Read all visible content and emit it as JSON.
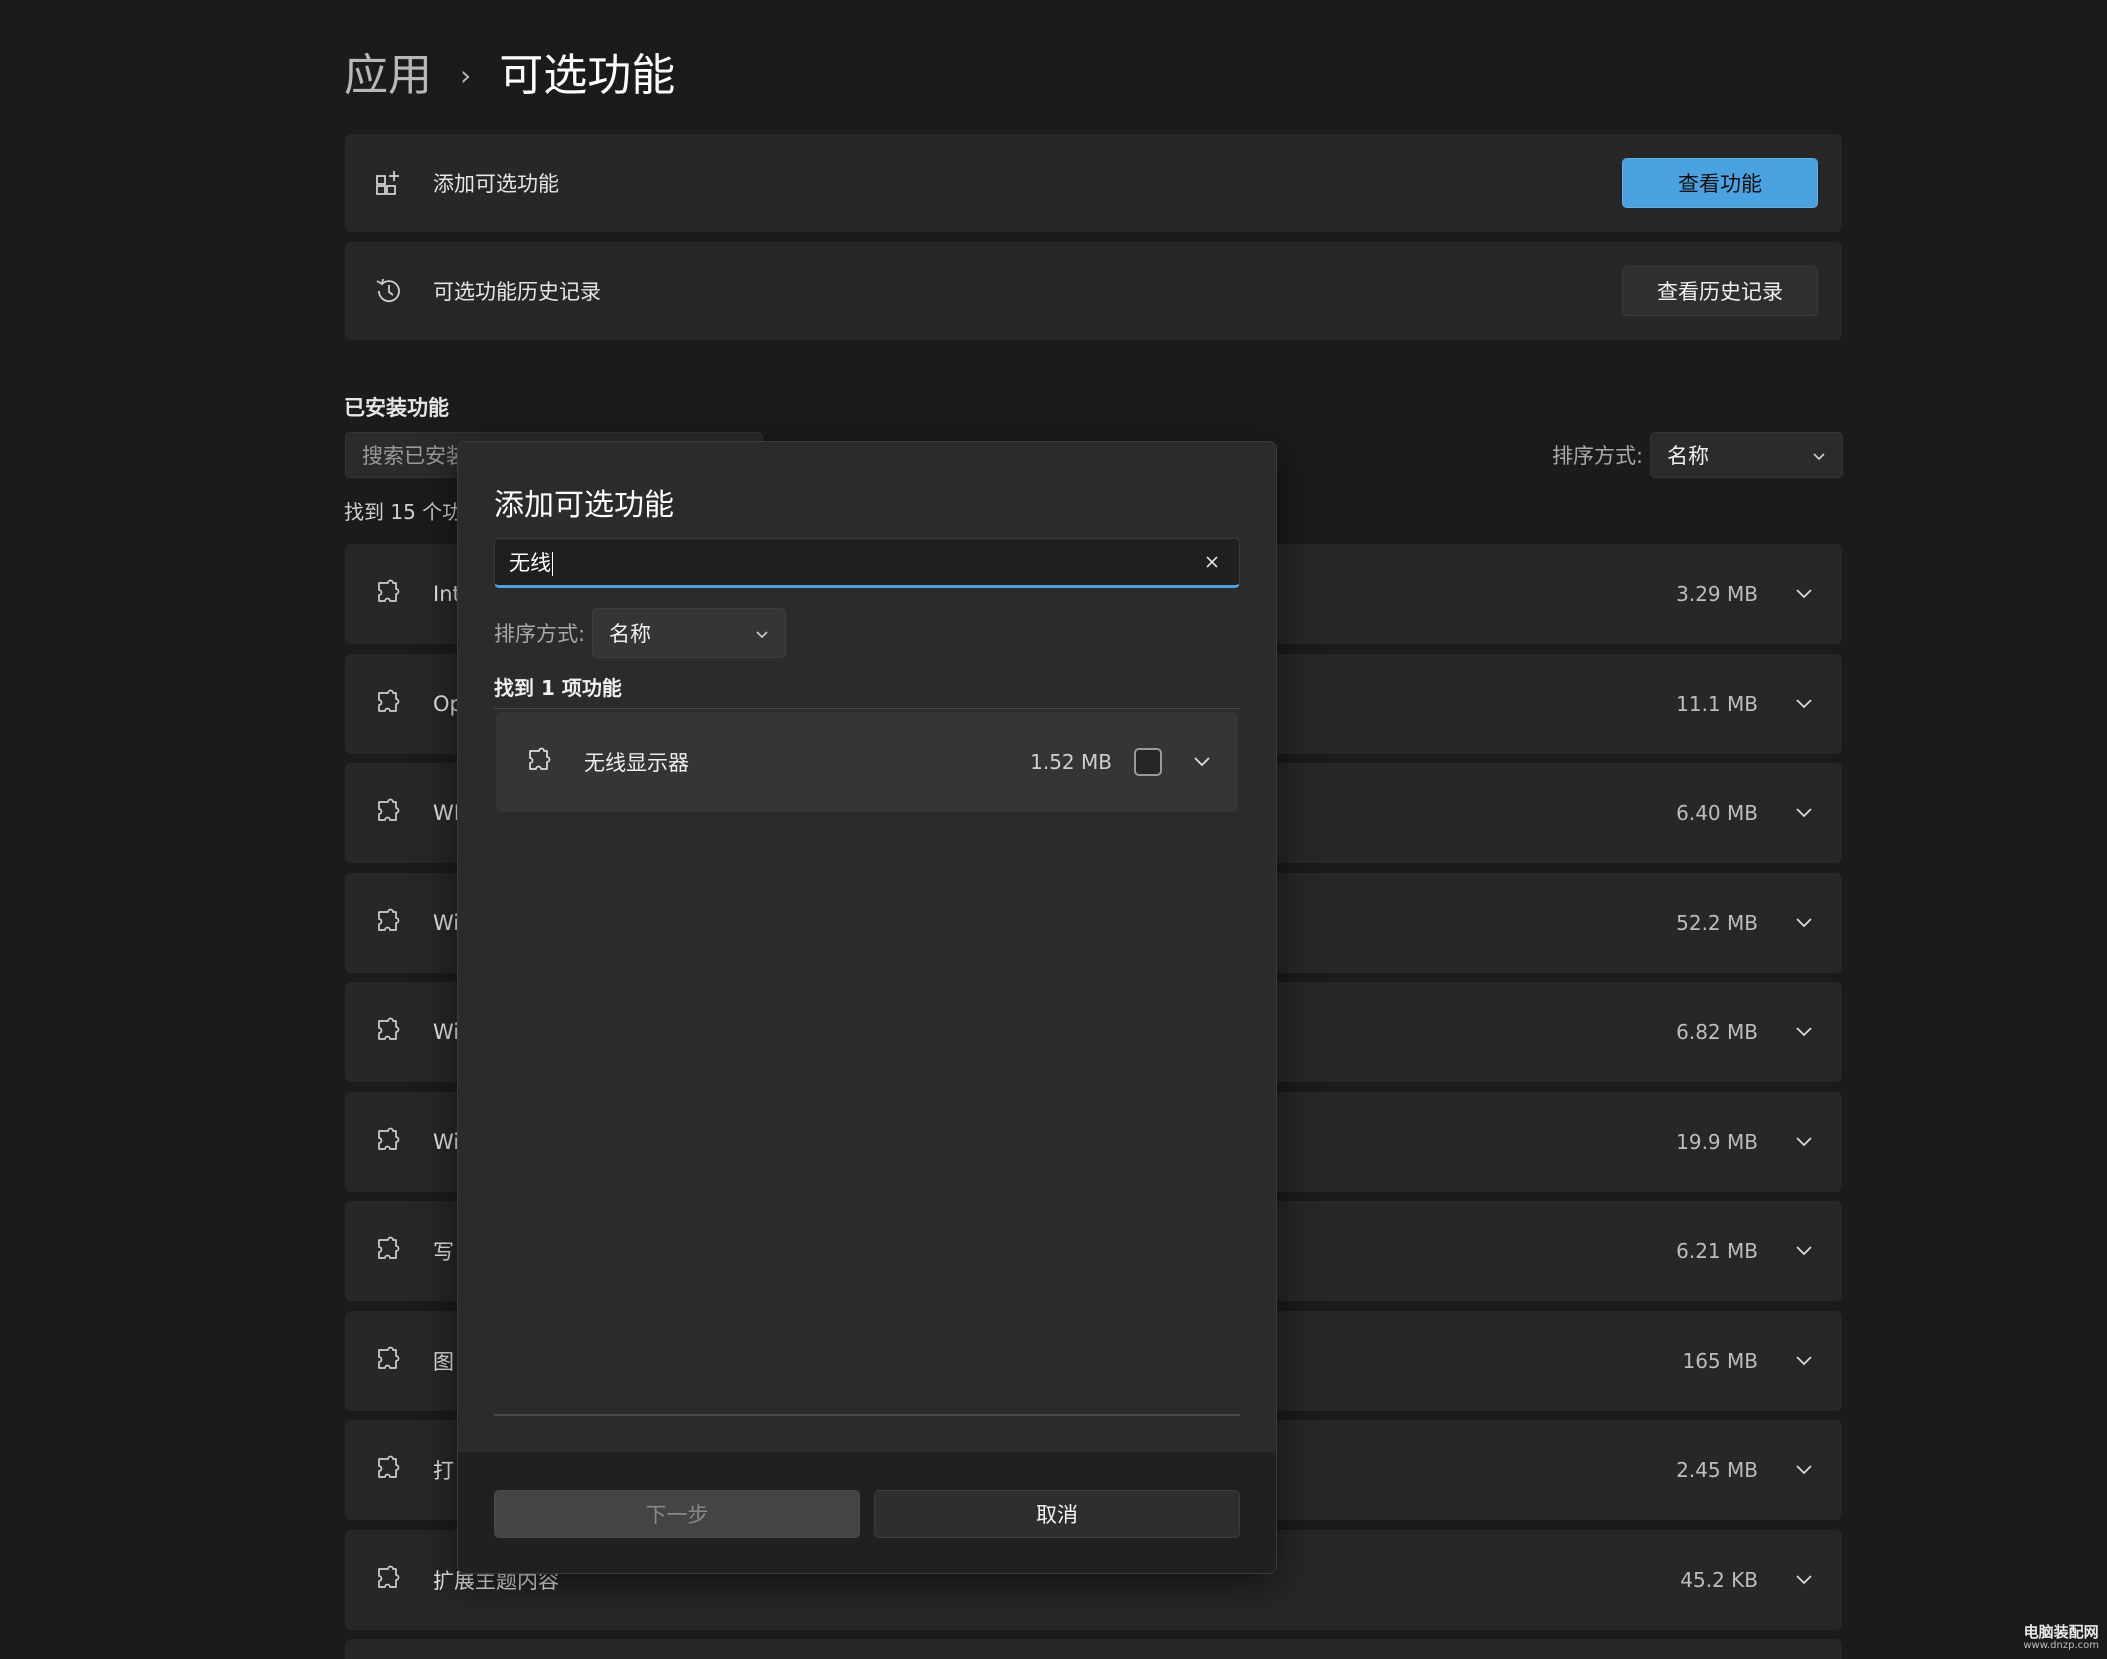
{
  "breadcrumb": {
    "parent": "应用",
    "separator": "›",
    "current": "可选功能"
  },
  "add_card": {
    "icon": "add-grid-icon",
    "label": "添加可选功能",
    "button": "查看功能"
  },
  "history_card": {
    "icon": "history-icon",
    "label": "可选功能历史记录",
    "button": "查看历史记录"
  },
  "installed": {
    "title": "已安装功能",
    "search_placeholder": "搜索已安装",
    "found_text": "找到 15 个功",
    "sort_label": "排序方式:",
    "sort_value": "名称",
    "items": [
      {
        "name": "Int",
        "size": "3.29 MB"
      },
      {
        "name": "Op",
        "size": "11.1 MB"
      },
      {
        "name": "WI",
        "size": "6.40 MB"
      },
      {
        "name": "Wi",
        "size": "52.2 MB"
      },
      {
        "name": "Wi",
        "size": "6.82 MB"
      },
      {
        "name": "Wi",
        "size": "19.9 MB"
      },
      {
        "name": "写",
        "size": "6.21 MB"
      },
      {
        "name": "图",
        "size": "165 MB"
      },
      {
        "name": "打",
        "size": "2.45 MB"
      },
      {
        "name": "扩展主题内容",
        "size": "45.2 KB"
      }
    ]
  },
  "dialog": {
    "title": "添加可选功能",
    "search_value": "无线",
    "sort_label": "排序方式:",
    "sort_value": "名称",
    "found_text": "找到 1 项功能",
    "items": [
      {
        "name": "无线显示器",
        "size": "1.52 MB",
        "checked": false
      }
    ],
    "next_button": "下一步",
    "cancel_button": "取消"
  },
  "watermark": {
    "main": "电脑装配网",
    "sub": "www.dnzp.com"
  },
  "colors": {
    "background": "#1b1b1b",
    "card": "#272727",
    "accent": "#4aa3e0",
    "dialog": "#2b2b2b"
  }
}
